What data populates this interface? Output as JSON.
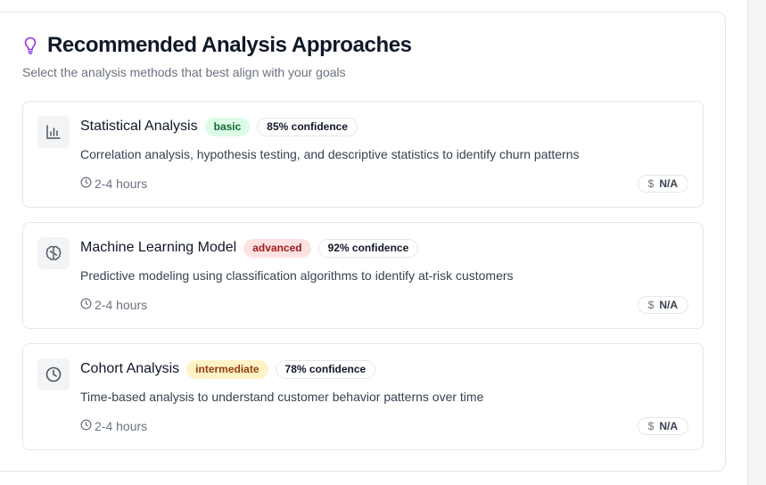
{
  "header": {
    "title": "Recommended Analysis Approaches",
    "subtitle": "Select the analysis methods that best align with your goals",
    "icon": "lightbulb-icon",
    "accent_color": "#9333ea"
  },
  "approaches": [
    {
      "name": "Statistical Analysis",
      "icon": "bar-chart-icon",
      "level": "basic",
      "confidence": "85% confidence",
      "description": "Correlation analysis, hypothesis testing, and descriptive statistics to identify churn patterns",
      "duration": "2-4 hours",
      "cost": "N/A",
      "cost_symbol": "$"
    },
    {
      "name": "Machine Learning Model",
      "icon": "brain-icon",
      "level": "advanced",
      "confidence": "92% confidence",
      "description": "Predictive modeling using classification algorithms to identify at-risk customers",
      "duration": "2-4 hours",
      "cost": "N/A",
      "cost_symbol": "$"
    },
    {
      "name": "Cohort Analysis",
      "icon": "clock-icon",
      "level": "intermediate",
      "confidence": "78% confidence",
      "description": "Time-based analysis to understand customer behavior patterns over time",
      "duration": "2-4 hours",
      "cost": "N/A",
      "cost_symbol": "$"
    }
  ],
  "colors": {
    "basic_bg": "#dcfce7",
    "advanced_bg": "#fee2e2",
    "intermediate_bg": "#fef3c7"
  }
}
